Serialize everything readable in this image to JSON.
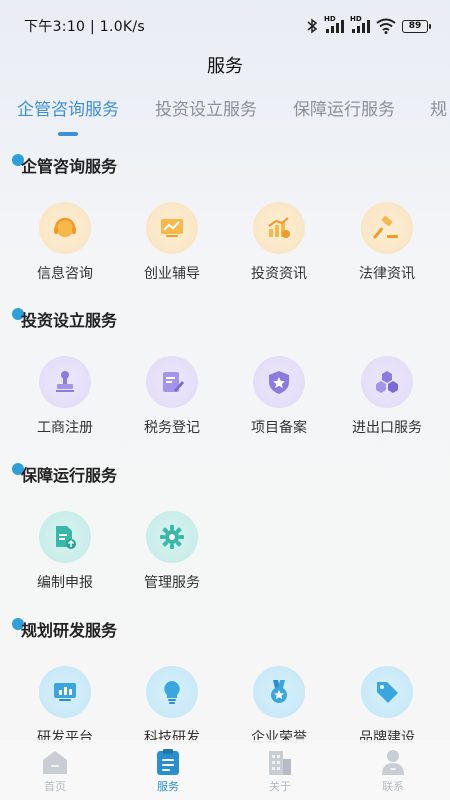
{
  "status": {
    "time": "下午3:10 | 1.0K/s",
    "hd1": "HD",
    "hd2": "HD",
    "battery": "89"
  },
  "page_title": "服务",
  "tabs": [
    "企管咨询服务",
    "投资设立服务",
    "保障运行服务",
    "规"
  ],
  "sections": [
    {
      "title": "企管咨询服务",
      "items": [
        {
          "label": "信息咨询",
          "icon": "headset-icon",
          "color": "orange"
        },
        {
          "label": "创业辅导",
          "icon": "chart-board-icon",
          "color": "orange"
        },
        {
          "label": "投资资讯",
          "icon": "bar-chart-coin-icon",
          "color": "orange"
        },
        {
          "label": "法律资讯",
          "icon": "gavel-icon",
          "color": "orange"
        }
      ]
    },
    {
      "title": "投资设立服务",
      "items": [
        {
          "label": "工商注册",
          "icon": "stamp-icon",
          "color": "purple"
        },
        {
          "label": "税务登记",
          "icon": "edit-document-icon",
          "color": "purple"
        },
        {
          "label": "项目备案",
          "icon": "shield-star-icon",
          "color": "purple"
        },
        {
          "label": "进出口服务",
          "icon": "cubes-icon",
          "color": "purple"
        }
      ]
    },
    {
      "title": "保障运行服务",
      "items": [
        {
          "label": "编制申报",
          "icon": "document-upload-icon",
          "color": "teal"
        },
        {
          "label": "管理服务",
          "icon": "gear-icon",
          "color": "teal"
        }
      ]
    },
    {
      "title": "规划研发服务",
      "items": [
        {
          "label": "研发平台",
          "icon": "monitor-chart-icon",
          "color": "blue"
        },
        {
          "label": "科技研发",
          "icon": "lightbulb-icon",
          "color": "blue"
        },
        {
          "label": "企业荣誉",
          "icon": "medal-icon",
          "color": "blue"
        },
        {
          "label": "品牌建设",
          "icon": "tag-icon",
          "color": "blue"
        }
      ]
    }
  ],
  "bottom_nav": [
    {
      "label": "首页",
      "icon": "home-icon",
      "active": false
    },
    {
      "label": "服务",
      "icon": "clipboard-icon",
      "active": true
    },
    {
      "label": "关于",
      "icon": "building-icon",
      "active": false
    },
    {
      "label": "联系",
      "icon": "contact-person-icon",
      "active": false
    }
  ],
  "colors": {
    "accent": "#3d8fd8",
    "section_dot": "#2f9fd9",
    "tab_inactive": "#8a8f98",
    "nav_active": "#2a8fce",
    "nav_inactive": "#b7bcc4"
  }
}
